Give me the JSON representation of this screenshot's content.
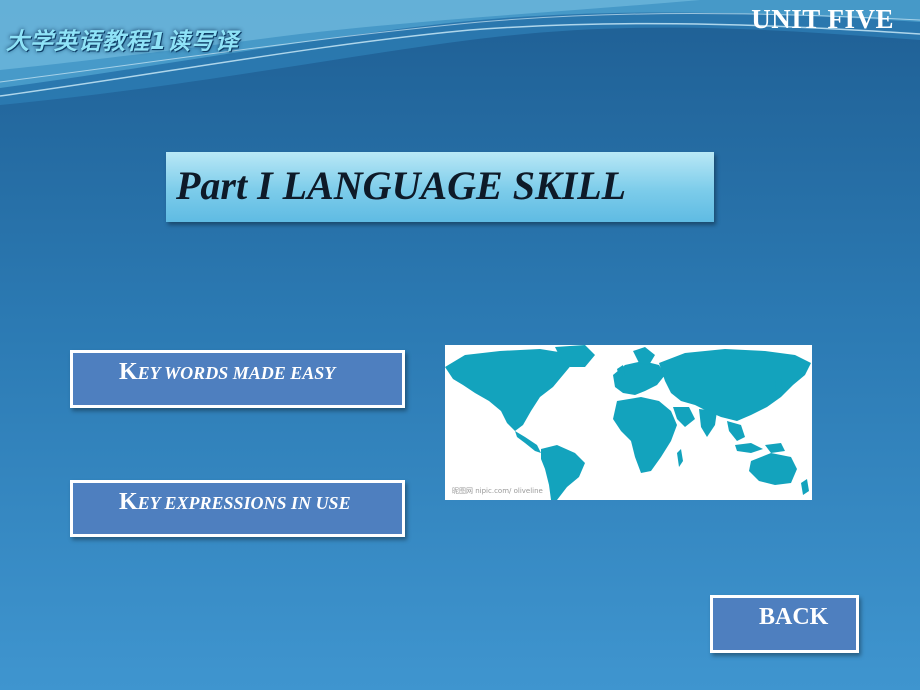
{
  "header": {
    "course_title": "大学英语教程1读写译",
    "unit": "UNIT FIVE"
  },
  "banner": {
    "title": "Part I LANGUAGE SKILL"
  },
  "buttons": {
    "key_words": {
      "cap": "K",
      "rest": "EY WORDS MADE EASY"
    },
    "key_expressions": {
      "cap": "K",
      "rest": "EY EXPRESSIONS IN USE"
    },
    "back": "BACK"
  },
  "map": {
    "image": "world-map",
    "watermark": "昵图网 nipic.com/ oliveline",
    "color": "#13a3bd"
  },
  "colors": {
    "background_top": "#1f5f94",
    "background_bottom": "#3f95cf",
    "button": "#4e7fbf",
    "banner": "#7cccea"
  }
}
